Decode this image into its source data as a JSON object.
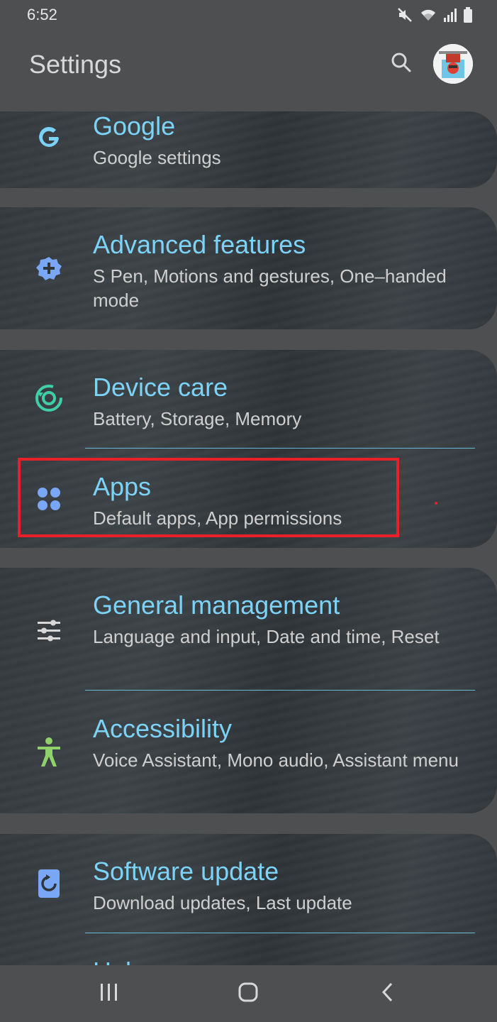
{
  "status_bar": {
    "time": "6:52",
    "icons": [
      "mute-icon",
      "wifi-icon",
      "signal-icon",
      "battery-icon"
    ]
  },
  "header": {
    "title": "Settings",
    "search_icon": "search-icon",
    "avatar_icon": "avatar"
  },
  "items": [
    {
      "title": "Google",
      "subtitle": "Google settings",
      "icon": "google-icon",
      "icon_color": "#7dd3f7"
    },
    {
      "title": "Advanced features",
      "subtitle": "S Pen, Motions and gestures, One–handed mode",
      "icon": "gear-plus-icon",
      "icon_color": "#7aa7f5"
    },
    {
      "title": "Device care",
      "subtitle": "Battery, Storage, Memory",
      "icon": "device-care-icon",
      "icon_color": "#3fcfa6"
    },
    {
      "title": "Apps",
      "subtitle": "Default apps, App permissions",
      "icon": "apps-icon",
      "icon_color": "#7aa7f5"
    },
    {
      "title": "General management",
      "subtitle": "Language and input, Date and time, Reset",
      "icon": "sliders-icon",
      "icon_color": "#d8d8d8"
    },
    {
      "title": "Accessibility",
      "subtitle": "Voice Assistant, Mono audio, Assistant menu",
      "icon": "accessibility-icon",
      "icon_color": "#8fd16a"
    },
    {
      "title": "Software update",
      "subtitle": "Download updates, Last update",
      "icon": "software-update-icon",
      "icon_color": "#7aa7f5"
    },
    {
      "title": "Help",
      "subtitle": "",
      "icon": "help-icon",
      "icon_color": "#7aa7f5"
    }
  ],
  "colors": {
    "accent": "#7dd3f7",
    "highlight": "#e8202a",
    "background": "#4d4f51"
  },
  "nav": {
    "recents_icon": "recents-icon",
    "home_icon": "home-icon",
    "back_icon": "back-icon"
  }
}
